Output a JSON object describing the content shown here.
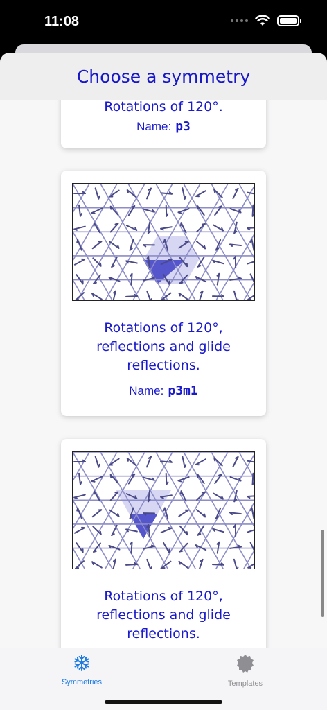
{
  "status_bar": {
    "time": "11:08"
  },
  "header": {
    "title": "Choose a symmetry"
  },
  "cards": [
    {
      "desc": "Rotations of 120°.",
      "name_label": "Name:",
      "name": "p3"
    },
    {
      "desc_lines": [
        "Rotations of 120°,",
        "reflections and glide",
        "reflections."
      ],
      "name_label": "Name:",
      "name": "p3m1"
    },
    {
      "desc_lines": [
        "Rotations of 120°,",
        "reflections and glide",
        "reflections."
      ]
    }
  ],
  "tabs": [
    {
      "label": "Symmetries",
      "icon": "snowflake-icon",
      "selected": true,
      "color": "#1e7be0"
    },
    {
      "label": "Templates",
      "icon": "gear-badge-icon",
      "selected": false,
      "color": "#8e8e93"
    }
  ],
  "colors": {
    "accent_text": "#1a1acc",
    "tile_dark": "#5555cc",
    "tile_light": "#c9c9f0",
    "lines": "#8c8cc8"
  }
}
